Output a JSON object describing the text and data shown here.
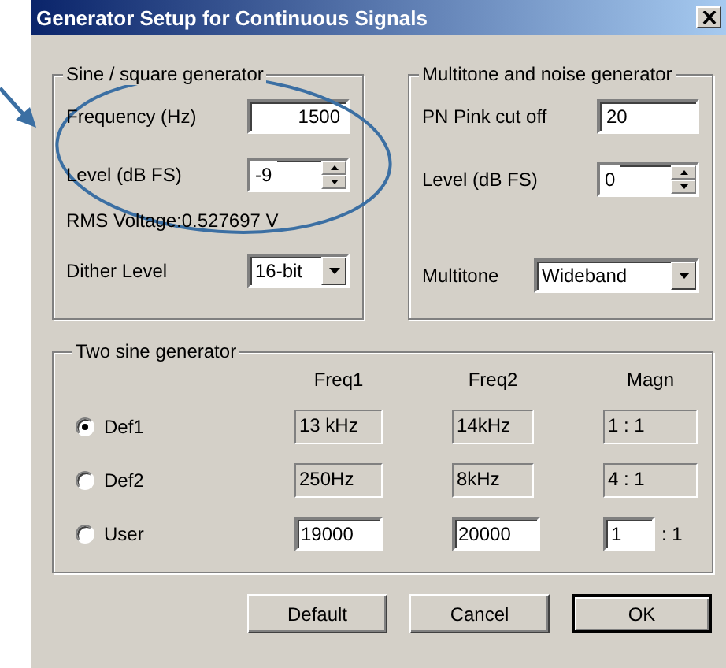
{
  "window": {
    "title": "Generator Setup for Continuous Signals"
  },
  "sine_group": {
    "title": "Sine / square generator",
    "frequency": {
      "label": "Frequency (Hz)",
      "value": "1500"
    },
    "level": {
      "label": "Level (dB FS)",
      "value": "-9"
    },
    "rms_voltage": "RMS Voltage:0.527697 V",
    "dither": {
      "label": "Dither Level",
      "value": "16-bit"
    }
  },
  "noise_group": {
    "title": "Multitone and noise generator",
    "pink_cutoff": {
      "label": "PN Pink cut off",
      "value": "20"
    },
    "level": {
      "label": "Level (dB FS)",
      "value": "0"
    },
    "multitone": {
      "label": "Multitone",
      "value": "Wideband"
    }
  },
  "two_sine_group": {
    "title": "Two sine generator",
    "columns": [
      "Freq1",
      "Freq2",
      "Magn"
    ],
    "rows": [
      {
        "label": "Def1",
        "selected": true,
        "kind": "readonly",
        "freq1": "13 kHz",
        "freq2": "14kHz",
        "magn": "1 : 1"
      },
      {
        "label": "Def2",
        "selected": false,
        "kind": "readonly",
        "freq1": "250Hz",
        "freq2": "8kHz",
        "magn": "4 : 1"
      },
      {
        "label": "User",
        "selected": false,
        "kind": "editable",
        "freq1": "19000",
        "freq2": "20000",
        "magn": "1",
        "magn_suffix": ": 1"
      }
    ]
  },
  "buttons": [
    {
      "label": "Default",
      "default": false
    },
    {
      "label": "Cancel",
      "default": false
    },
    {
      "label": "OK",
      "default": true
    }
  ]
}
